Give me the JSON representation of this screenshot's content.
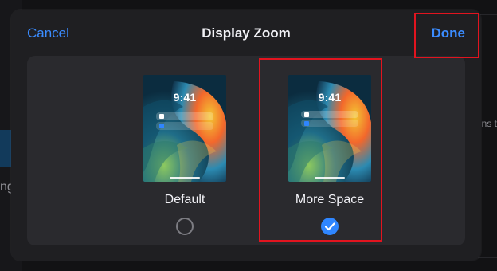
{
  "background": {
    "left_text": "ng",
    "right_text": "ns t"
  },
  "modal": {
    "cancel_label": "Cancel",
    "title": "Display Zoom",
    "done_label": "Done",
    "options": [
      {
        "label": "Default",
        "time": "9:41",
        "selected": false
      },
      {
        "label": "More Space",
        "time": "9:41",
        "selected": true
      }
    ]
  },
  "colors": {
    "accent": "#3b8cff",
    "highlight": "#e1141f"
  },
  "icons": {
    "radio_unchecked": "radio-unchecked-icon",
    "radio_checked": "checkmark-circle-icon"
  }
}
